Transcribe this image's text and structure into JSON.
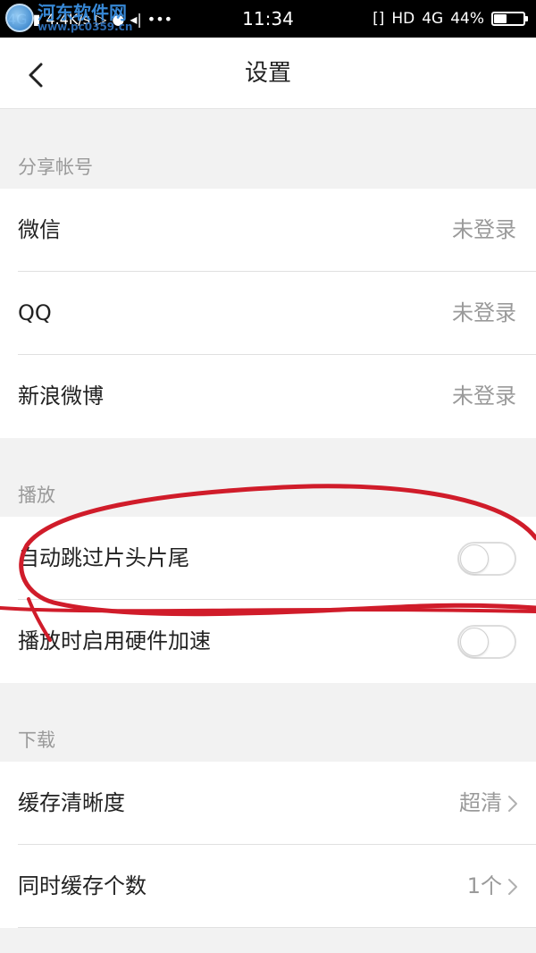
{
  "status_bar": {
    "network_left": "4G",
    "speed": "4.4K/s",
    "time": "11:34",
    "hd": "HD",
    "network_right": "4G",
    "battery": "44%",
    "battery_level": 0.44
  },
  "watermark": {
    "name": "河东软件网",
    "url": "www.pc0359.cn"
  },
  "nav": {
    "title": "设置"
  },
  "sections": {
    "share": {
      "header": "分享帐号",
      "items": [
        {
          "label": "微信",
          "value": "未登录"
        },
        {
          "label": "QQ",
          "value": "未登录"
        },
        {
          "label": "新浪微博",
          "value": "未登录"
        }
      ]
    },
    "play": {
      "header": "播放",
      "items": [
        {
          "label": "自动跳过片头片尾",
          "enabled": false
        },
        {
          "label": "播放时启用硬件加速",
          "enabled": false
        }
      ]
    },
    "download": {
      "header": "下载",
      "items": [
        {
          "label": "缓存清晰度",
          "value": "超清"
        },
        {
          "label": "同时缓存个数",
          "value": "1个"
        }
      ]
    }
  },
  "colors": {
    "annotation_stroke": "#d01c2a",
    "accent_watermark": "#3a8fe0"
  }
}
